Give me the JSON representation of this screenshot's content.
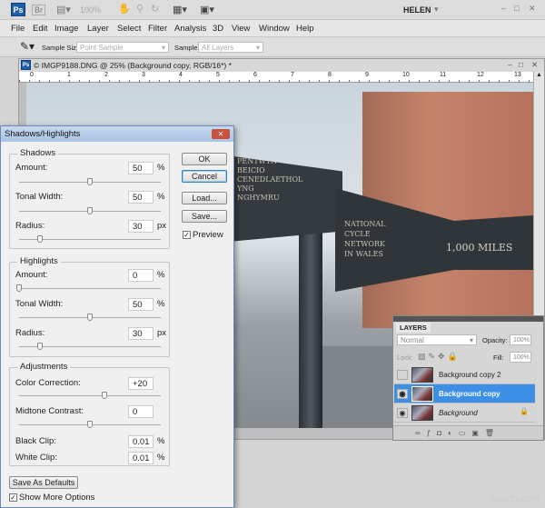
{
  "app": {
    "logo": "Ps",
    "bridge": "Br",
    "zoom": "100%",
    "user": "HELEN"
  },
  "menu": [
    "File",
    "Edit",
    "Image",
    "Layer",
    "Select",
    "Filter",
    "Analysis",
    "3D",
    "View",
    "Window",
    "Help"
  ],
  "options": {
    "sample_size_label": "Sample Size:",
    "sample_size_value": "Point Sample",
    "sample_label": "Sample:",
    "sample_value": "All Layers"
  },
  "document": {
    "title": "© IMGP9188.DNG @ 25% (Background copy, RGB/16*) *",
    "ruler": [
      "0",
      "1",
      "2",
      "3",
      "4",
      "5",
      "6",
      "7",
      "8",
      "9",
      "10",
      "11",
      "12",
      "13"
    ],
    "sign": {
      "left": "PENTWYN\nBEICIO\nCENEDLAETHOL\nYNG\nNGHYMRU",
      "middle": "NATIONAL\nCYCLE\nNETWORK\nIN WALES",
      "right": "1,000 MILES"
    }
  },
  "dialog": {
    "title": "Shadows/Highlights",
    "shadows": {
      "title": "Shadows",
      "amount": {
        "label": "Amount:",
        "value": "50",
        "unit": "%",
        "pct": 50
      },
      "tonal": {
        "label": "Tonal Width:",
        "value": "50",
        "unit": "%",
        "pct": 50
      },
      "radius": {
        "label": "Radius:",
        "value": "30",
        "unit": "px",
        "pct": 15
      }
    },
    "highlights": {
      "title": "Highlights",
      "amount": {
        "label": "Amount:",
        "value": "0",
        "unit": "%",
        "pct": 0
      },
      "tonal": {
        "label": "Tonal Width:",
        "value": "50",
        "unit": "%",
        "pct": 50
      },
      "radius": {
        "label": "Radius:",
        "value": "30",
        "unit": "px",
        "pct": 15
      }
    },
    "adjustments": {
      "title": "Adjustments",
      "color": {
        "label": "Color Correction:",
        "value": "+20",
        "pct": 60
      },
      "midtone": {
        "label": "Midtone Contrast:",
        "value": "0",
        "pct": 50
      },
      "black": {
        "label": "Black Clip:",
        "value": "0.01",
        "unit": "%"
      },
      "white": {
        "label": "White Clip:",
        "value": "0.01",
        "unit": "%"
      }
    },
    "buttons": {
      "ok": "OK",
      "cancel": "Cancel",
      "load": "Load...",
      "save": "Save..."
    },
    "preview": "Preview",
    "save_defaults": "Save As Defaults",
    "more_options": "Show More Options"
  },
  "layers": {
    "tab": "LAYERS",
    "blend": "Normal",
    "opacity_label": "Opacity:",
    "opacity": "100%",
    "lock_label": "Lock:",
    "fill_label": "Fill:",
    "fill": "100%",
    "items": [
      {
        "name": "Background copy 2"
      },
      {
        "name": "Background copy"
      },
      {
        "name": "Background"
      }
    ]
  },
  "watermark": "wsxdn.com"
}
